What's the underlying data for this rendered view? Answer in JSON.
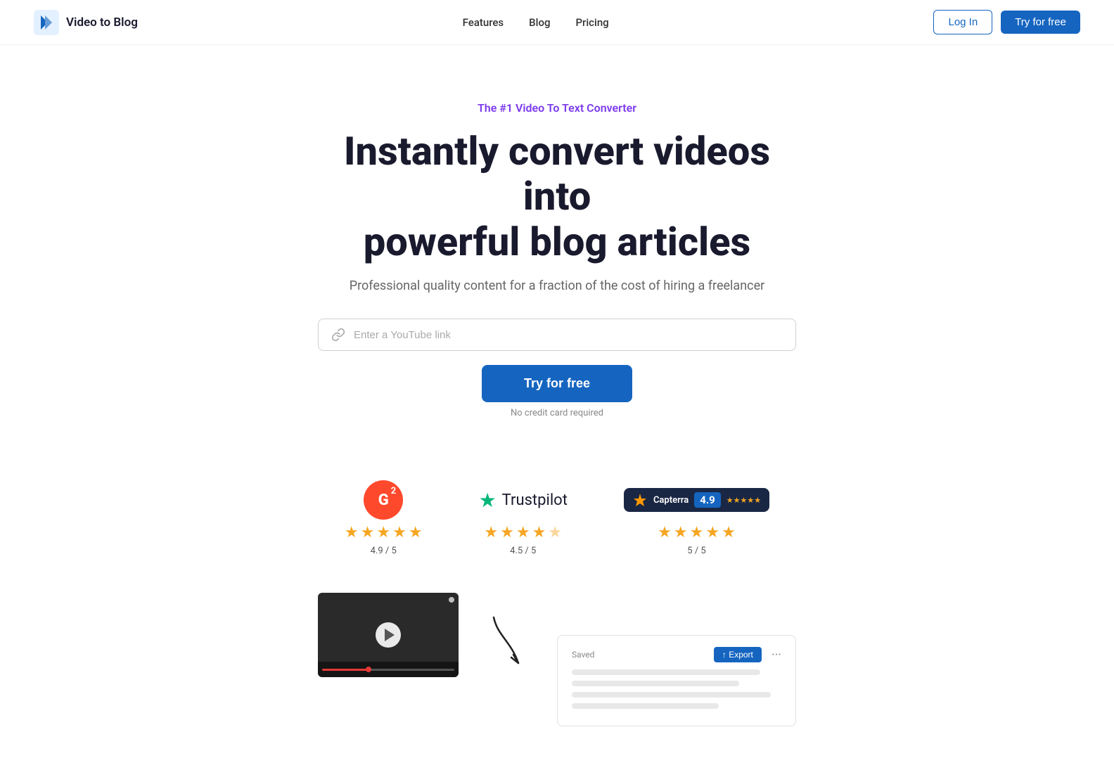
{
  "nav": {
    "logo_text": "Video to Blog",
    "links": [
      {
        "label": "Features",
        "id": "features"
      },
      {
        "label": "Blog",
        "id": "blog"
      },
      {
        "label": "Pricing",
        "id": "pricing"
      }
    ],
    "login_label": "Log In",
    "try_label": "Try for free"
  },
  "hero": {
    "tagline": "The #1 Video To Text Converter",
    "title_line1": "Instantly convert videos into",
    "title_line2": "powerful blog articles",
    "subtitle": "Professional quality content for a fraction of the cost of hiring a freelancer",
    "input_placeholder": "Enter a YouTube link",
    "try_label": "Try for free",
    "no_cc": "No credit card required"
  },
  "ratings": [
    {
      "platform": "G2",
      "score": "4.9 / 5",
      "stars": 5,
      "half": false
    },
    {
      "platform": "Trustpilot",
      "score": "4.5 / 5",
      "stars": 4,
      "half": true
    },
    {
      "platform": "Capterra",
      "score": "5 / 5",
      "stars": 5,
      "half": false,
      "badge_score": "4.9"
    }
  ],
  "demo": {
    "blog_saved_label": "Saved",
    "blog_export_label": "↑ Export"
  }
}
